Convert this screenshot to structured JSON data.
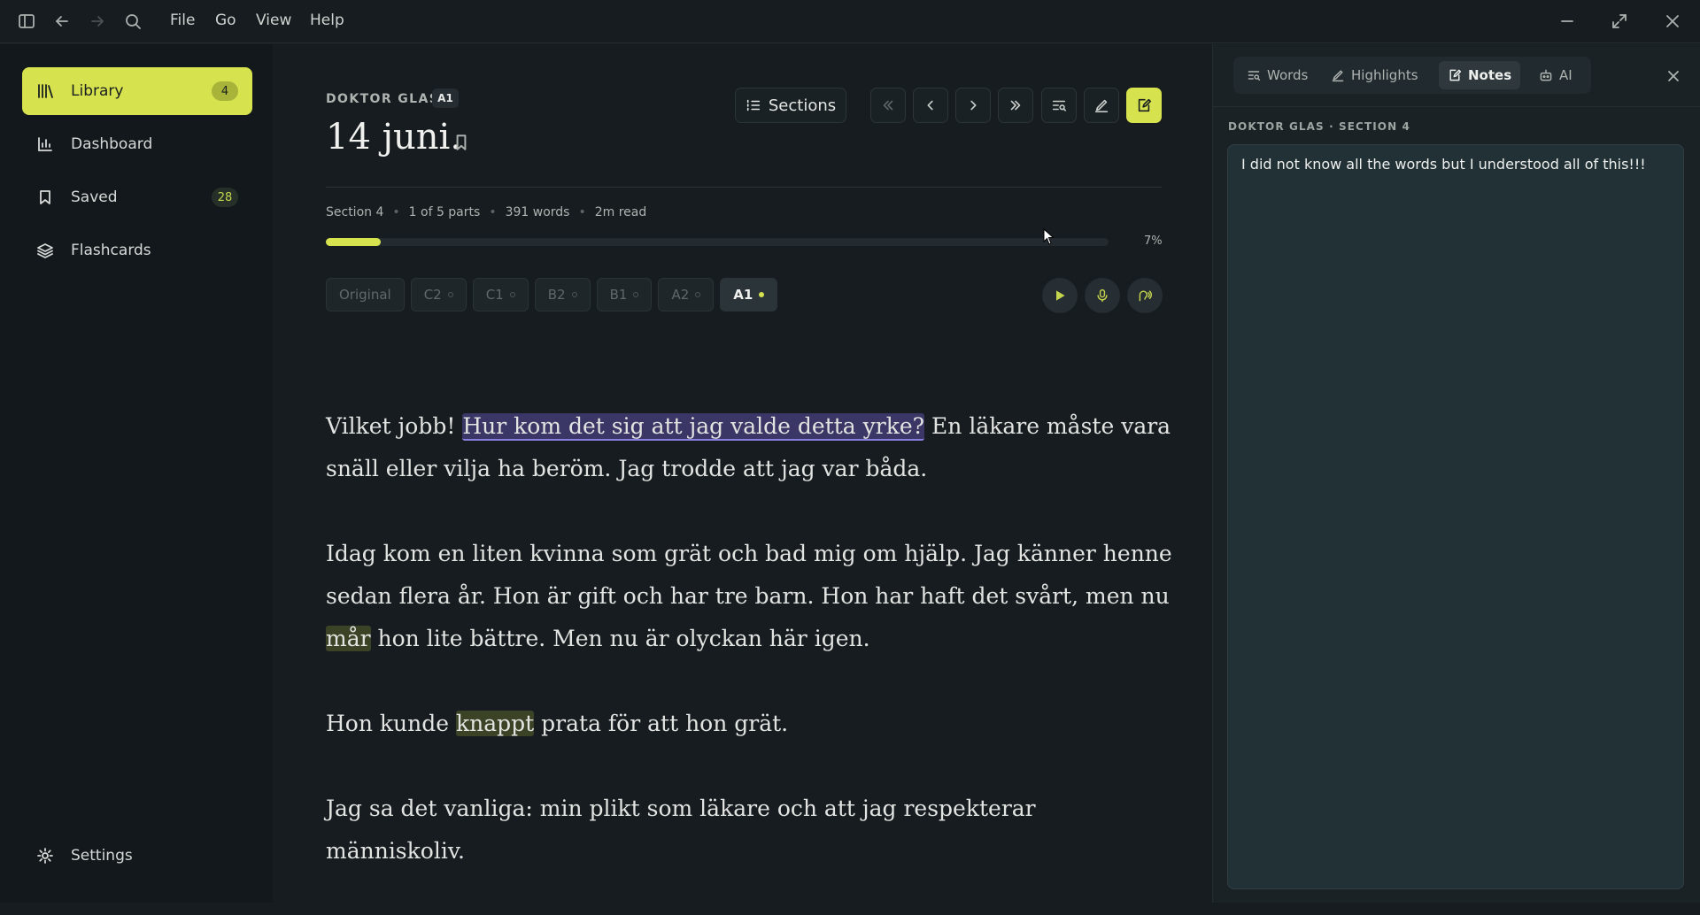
{
  "menu": {
    "file": "File",
    "go": "Go",
    "view": "View",
    "help": "Help"
  },
  "sidebar": {
    "items": [
      {
        "label": "Library",
        "badge": "4",
        "icon": "library-icon"
      },
      {
        "label": "Dashboard",
        "icon": "bar-chart-icon"
      },
      {
        "label": "Saved",
        "badge": "28",
        "icon": "bookmark-icon"
      },
      {
        "label": "Flashcards",
        "icon": "layers-icon"
      }
    ],
    "settings": "Settings"
  },
  "header": {
    "book_title": "DOKTOR GLAS",
    "level": "A1",
    "chapter_title": "14 juni."
  },
  "toolbar": {
    "sections_label": "Sections"
  },
  "meta": {
    "section": "Section 4",
    "parts": "1 of 5 parts",
    "words": "391 words",
    "read_time": "2m read"
  },
  "progress": {
    "percent": 7,
    "label": "7%"
  },
  "levels": [
    {
      "label": "Original",
      "dot": false,
      "active": false
    },
    {
      "label": "C2",
      "dot": true,
      "active": false
    },
    {
      "label": "C1",
      "dot": true,
      "active": false
    },
    {
      "label": "B2",
      "dot": true,
      "active": false
    },
    {
      "label": "B1",
      "dot": true,
      "active": false
    },
    {
      "label": "A2",
      "dot": true,
      "active": false
    },
    {
      "label": "A1",
      "dot": true,
      "active": true
    }
  ],
  "text": {
    "p1_before": "Vilket jobb! ",
    "p1_highlight": "Hur kom det sig att jag valde detta yrke?",
    "p1_after": " En läkare måste vara snäll eller vilja ha beröm. Jag trodde att jag var båda.",
    "p2_before": "Idag kom en liten kvinna som grät och bad mig om hjälp. Jag känner henne sedan flera år. Hon är gift och har tre barn. Hon har haft det svårt, men nu ",
    "p2_word": "mår",
    "p2_after": " hon lite bättre. Men nu är olyckan här igen.",
    "p3_before": "Hon kunde ",
    "p3_word": "knappt",
    "p3_after": " prata för att hon grät.",
    "p4": "Jag sa det vanliga: min plikt som läkare och att jag respekterar människoliv."
  },
  "panel": {
    "tabs": [
      {
        "label": "Words",
        "icon": "word-search-icon"
      },
      {
        "label": "Highlights",
        "icon": "highlighter-icon"
      },
      {
        "label": "Notes",
        "icon": "note-edit-icon",
        "active": true
      },
      {
        "label": "AI",
        "icon": "robot-icon"
      }
    ],
    "note_label": "DOKTOR GLAS · SECTION 4",
    "note_text": "I did not know all the words but I understood all of this!!!"
  },
  "colors": {
    "accent": "#d6e24e",
    "highlight_phrase": "#3a3766",
    "highlight_word": "#3b4327",
    "background": "#161c20"
  }
}
